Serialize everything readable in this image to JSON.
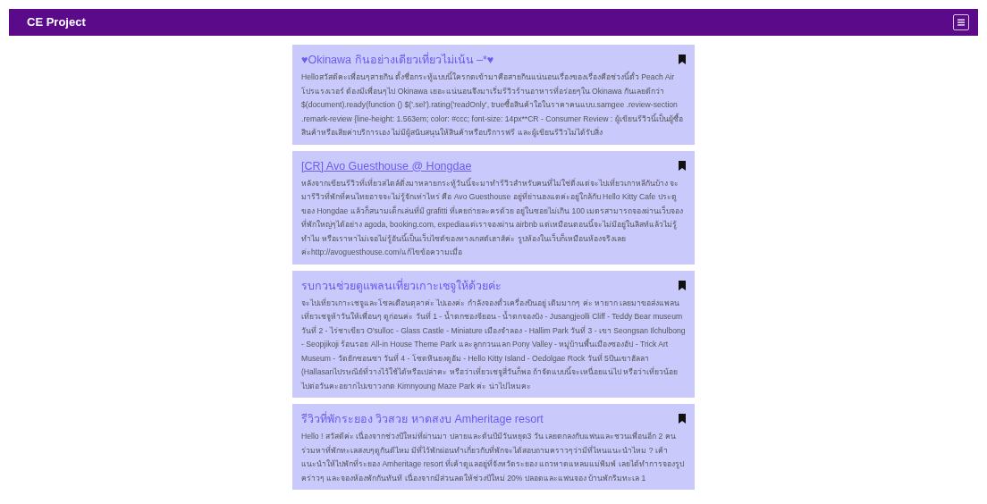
{
  "navbar": {
    "brand": "CE Project"
  },
  "posts": [
    {
      "title": "♥Okinawa กินอย่างเดียวเที่ยวไม่เน้น –*♥",
      "link": false,
      "excerpt": "Helloสวัสดีคะเพื่อนๆสายกิน ตั้งชื่อกระทู้แบบนี้ใครกดเข้ามาคือสายกินแน่นอนเรื่องของเรื่องคือช่วงนี้ตั๋ว Peach Air โปรแรงเวอร์ ต้องมีเพื่อนๆไป Okinawa เยอะแน่นอนจึงมาเริ่มรีวิวร้านอาหารที่อร่อยๆใน Okinawa กันเลยดีกว่า $(document).ready(function () $('.sel').rating('readOnly', trueซื้อสินค้าใอในราคาคนแบบ.samgee .review-section .remark-review {line-height: 1.563em; color: #ccc; font-size: 14px**CR - Consumer Review : ผู้เขียนรีวิวนี้เป็นผู้ซื้อสินค้าหรือเสียค่าบริการเอง ไม่มีผู้สนับสนุนให้สินค้าหรือบริการฟรี และผู้เขียนรีวิวไม่ได้รับสิ่ง"
    },
    {
      "title": "[CR] Avo Guesthouse @ Hongdae",
      "link": true,
      "excerpt": "หลังจากเขียนรีวิวที่เที่ยวสไตล์ติ่งมาหลายกระทู้วันนี้จะมาทำรีวิวสำหรับคนที่ไม่ใช่ติ่งแต่จะไปเที่ยวเกาหลีกันบ้าง จะมารีวิวที่พักที่คนไทยอาจจะไม่รู้จักเท่าไหร่ คือ Avo Guesthouse อยู่ที่ย่านฮงแดค่ะอยู่ใกล้กับ Hello Kitty Cafe ประตูของ Hongdae แล้วก็สนามเด็กเล่นที่มี grafitti ที่เคยถ่ายละครด้วย อยู่ในซอยไม่เกิน 100 เมตรสามารถจองผ่านเว็บจองที่พักใหญ่ๆได้อย่าง agoda, booking.com, expediaแต่เราจองผ่าน airbnb แต่เหมือนตอนนี้จะไม่มีอยู่ในลิสท์แล้วไม่รู้ทำไม หรือเราหาไม่เจอไม่รู้อันนี้เป็นเว็บไซต์ของทางเกสต์เฮาส์ค่ะ รูปห้องในเว็บก็เหมือนห้องจริงเลย ค่ะhttp://avoguesthouse.com/แก้ไขข้อความเมื่อ"
    },
    {
      "title": "รบกวนช่วยดูแพลนเที่ยวเกาะเชจูให้ด้วยค่ะ",
      "link": false,
      "excerpt": "จะไปเที่ยวเกาะเชจูและโซลเดือนตุลาค่ะ ไปเองค่ะ กำลังจองตั๋วเครื่องบินอยู่ เติมมากๆ ค่ะ หายาก เลยมาขอส่งแพลนเที่ยวเชจูห้าวันให้เพื่อนๆ ดูก่อนค่ะ วันที่ 1 - น้ำตกชองจียอน - น้ำตกจองบัง - Jusangjeolli Cliff - Teddy Bear museum วันที่ 2 - ไร่ชาเขียว O'sulloc - Glass Castle - Miniature เมืองจำลอง - Hallim Park วันที่ 3 - เขา Seongsan Ilchulbong - Seopjikoji ร้อนรอย All-in House Theme Park และลูกกวนแลก Pony Valley - หมู่บ้านพื้นเมืองซองอัป - Trick Art Museum - วัดยักซอนซา วันที่ 4 - โซดหินยงดูอัม - Hello Kitty Island - Oedolgae Rock วันที่ 5ปีนเขาฮัลลา (Hallasanไปรษณีย์ที่วางไว้ใช้ได้หรือเปล่าคะ หรือว่าเที่ยวเชจูสี่วันก็พอ ถ้าจัดแบบนี้จะเหนื่อยแน่ไป หรือว่าเที่ยวน้อยไปต่อวันคะอยากไปเขาวงกต Kimnyoung Maze Park ค่ะ น่าไปไหมคะ"
    },
    {
      "title": "รีวิวที่พักระยอง วิวสวย หาดสงบ Amheritage resort",
      "link": false,
      "excerpt": "Hello ! สวัสดีค่ะ เนื่องจากช่วงปีใหม่ที่ผ่านมา ปลายและต้นปีมีวันหยุด3 วัน เลยตกลงกับแฟนและชวนเพื่อนอีก 2 คน ร่วมหาที่พักทะเลสงบๆดูกันดีไหม มีที่ไว้พักผ่อนทำเกี่ยวกับที่พักจะได้สอบถามคราวๆว่ามีที่ไหนแนะนำไหม ? เค้าแนะนำให้ไปพักที่ระยอง Amheritage resort ที่เค้าดูแลอยู่ที่จังหวัดระยอง แถวหาดแหลมแม่พิมพ์ เลยได้ทำการจองรูปคร่าวๆ และจองห้องพักกันทันที เนื่องจากมีส่วนลดให้ช่วงปีใหม่ 20% ปลอดและแฟนจอง บ้านพักริมทะเล 1"
    }
  ]
}
